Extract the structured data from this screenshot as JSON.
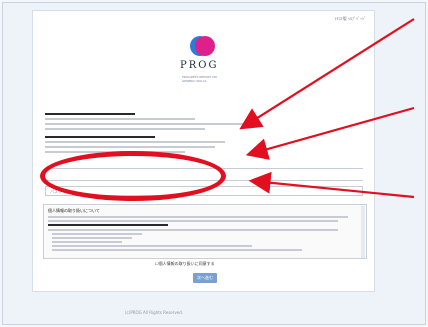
{
  "toplinks": "ﾃｷｽﾄ版   ﾍﾙﾌﾟﾍﾟｰｼﾞ",
  "logo": {
    "name": "PROG",
    "subtitle": "PROGRESS REPORT ON GENERIC SKILLS"
  },
  "password": {
    "placeholder": "パスワード"
  },
  "terms": {
    "heading": "個人情報の取り扱いについて"
  },
  "agree": {
    "label": "個人情報の取り扱いに同意する"
  },
  "submit": {
    "label": "次へ進む"
  },
  "footer": "(c)PROG All Rights Reserved.",
  "colors": {
    "highlight": "#e10f1f",
    "button": "#7aa0cf",
    "logo_mark": "#e0208a"
  }
}
